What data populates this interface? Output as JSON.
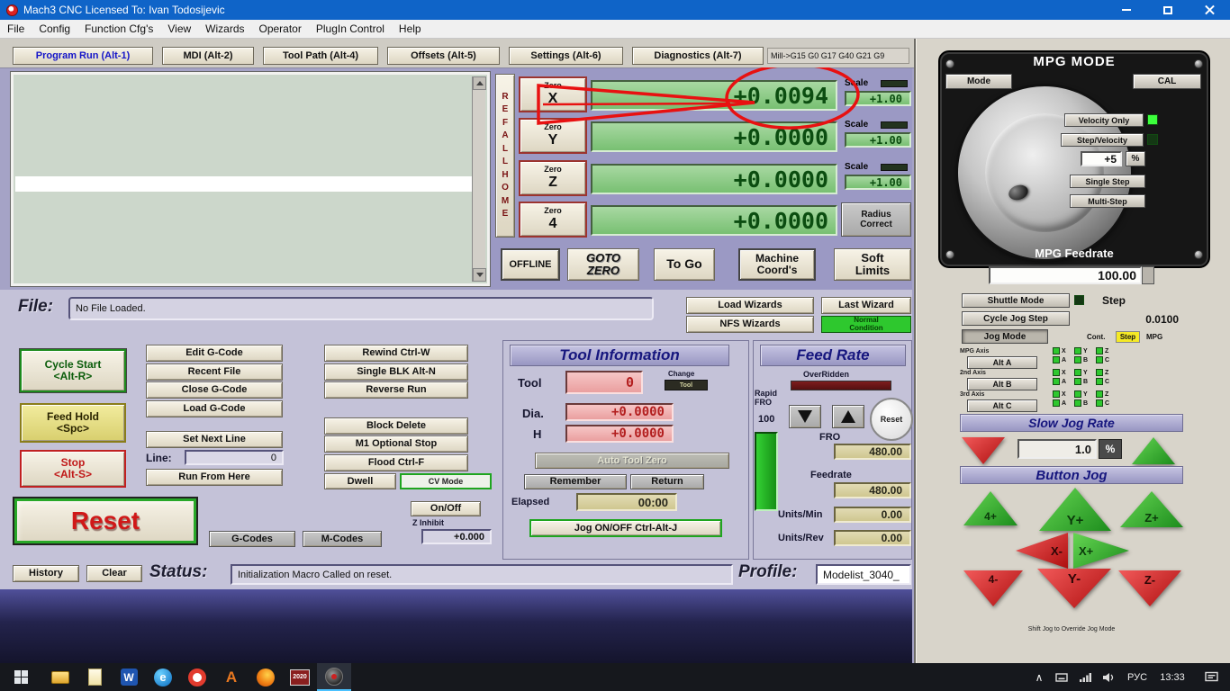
{
  "colors": {
    "titlebar_blue": "#0f64c8",
    "dro_green": "#8cc986",
    "dro_text_green": "#0b4d10",
    "annotation_red": "#e81111",
    "screen_lavender": "#a5a3c6",
    "status_green": "#2ec82e",
    "mpg_panel_black": "#161616"
  },
  "titlebar": {
    "title": "Mach3 CNC  Licensed To: Ivan Todosijevic"
  },
  "menubar": {
    "items": [
      "File",
      "Config",
      "Function Cfg's",
      "View",
      "Wizards",
      "Operator",
      "PlugIn Control",
      "Help"
    ]
  },
  "tabs": {
    "items": [
      "Program Run (Alt-1)",
      "MDI (Alt-2)",
      "Tool Path (Alt-4)",
      "Offsets (Alt-5)",
      "Settings (Alt-6)",
      "Diagnostics (Alt-7)"
    ],
    "gcode_modes": "Mill->G15  G0 G17 G40 G21 G9"
  },
  "dro": {
    "ref_all_home": "R\nE\nF\nA\nL\nL\nH\nO\nM\nE",
    "zero_word": "Zero",
    "axes": [
      {
        "letter": "X",
        "value": "+0.0094",
        "scale": "+1.00"
      },
      {
        "letter": "Y",
        "value": "+0.0000",
        "scale": "+1.00"
      },
      {
        "letter": "Z",
        "value": "+0.0000",
        "scale": "+1.00"
      },
      {
        "letter": "4",
        "value": "+0.0000"
      }
    ],
    "scale_label": "Scale",
    "radius_correct": "Radius\nCorrect",
    "offline": "OFFLINE",
    "goto_zero": "GOTO\nZERO",
    "to_go": "To Go",
    "machine_coords": "Machine\nCoord's",
    "soft_limits": "Soft\nLimits"
  },
  "file_row": {
    "label": "File:",
    "value": "No File Loaded.",
    "load_wizards": "Load Wizards",
    "last_wizard": "Last Wizard",
    "nfs_wizards": "NFS Wizards",
    "condition": "Normal\nCondition"
  },
  "run_controls": {
    "cycle_start": "Cycle Start\n<Alt-R>",
    "feed_hold": "Feed Hold\n<Spc>",
    "stop": "Stop\n<Alt-S>",
    "edit_gcode": "Edit G-Code",
    "recent_file": "Recent File",
    "close_gcode": "Close G-Code",
    "load_gcode": "Load G-Code",
    "set_next_line": "Set Next Line",
    "line_label": "Line:",
    "line_value": "0",
    "run_from_here": "Run From Here",
    "rewind": "Rewind Ctrl-W",
    "single_blk": "Single BLK Alt-N",
    "reverse_run": "Reverse Run",
    "block_delete": "Block Delete",
    "m1_optional_stop": "M1 Optional Stop",
    "flood": "Flood Ctrl-F",
    "dwell": "Dwell",
    "cv_mode": "CV Mode",
    "reset": "Reset",
    "gcodes": "G-Codes",
    "mcodes": "M-Codes",
    "on_off": "On/Off",
    "z_inhibit_label": "Z Inhibit",
    "z_inhibit_value": "+0.000"
  },
  "tool_info": {
    "title": "Tool Information",
    "tool_label": "Tool",
    "tool_value": "0",
    "change_label": "Change",
    "change_slot": "Tool",
    "dia_label": "Dia.",
    "dia_value": "+0.0000",
    "h_label": "H",
    "h_value": "+0.0000",
    "auto_tool_zero": "Auto Tool Zero",
    "remember": "Remember",
    "return": "Return",
    "elapsed_label": "Elapsed",
    "elapsed_value": "00:00",
    "jog_onoff": "Jog ON/OFF Ctrl-Alt-J"
  },
  "feed_rate": {
    "title": "Feed Rate",
    "overridden": "OverRidden",
    "rapid_label": "Rapid\nFRO",
    "rapid_value": "100",
    "reset_button": "Reset",
    "fro_label": "FRO",
    "fro_value": "480.00",
    "feedrate_label": "Feedrate",
    "feedrate_value": "480.00",
    "units_min_label": "Units/Min",
    "units_min_value": "0.00",
    "units_rev_label": "Units/Rev",
    "units_rev_value": "0.00"
  },
  "status_bar": {
    "history": "History",
    "clear": "Clear",
    "status_label": "Status:",
    "status_value": "Initialization Macro Called on reset.",
    "profile_label": "Profile:",
    "profile_value": "Modelist_3040_"
  },
  "mpg": {
    "title": "MPG MODE",
    "mode": "Mode",
    "cal": "CAL",
    "velocity_only": "Velocity Only",
    "step_velocity": "Step/Velocity",
    "step_size": "+5",
    "percent": "%",
    "single_step": "Single Step",
    "multi_step": "Multi-Step",
    "feedrate_label": "MPG Feedrate",
    "feedrate_value": "100.00",
    "shuttle_mode": "Shuttle Mode",
    "step_label": "Step",
    "cycle_jog_step": "Cycle Jog Step",
    "cycle_jog_value": "0.0100",
    "jog_mode": "Jog Mode",
    "col_cont": "Cont.",
    "col_step": "Step",
    "col_mpg": "MPG",
    "axis_rows": [
      {
        "label": "MPG Axis",
        "button": "Alt A"
      },
      {
        "label": "2nd Axis",
        "button": "Alt B"
      },
      {
        "label": "3rd Axis",
        "button": "Alt C"
      }
    ],
    "axis_letters": [
      "X",
      "Y",
      "Z",
      "A",
      "B",
      "C"
    ],
    "slow_jog_rate": "Slow Jog Rate",
    "slow_jog_value": "1.0",
    "slow_jog_percent": "%",
    "button_jog": "Button Jog",
    "jog_labels": [
      "4+",
      "Y+",
      "Z+",
      "X-",
      "X+",
      "4-",
      "Y-",
      "Z-"
    ],
    "caption": "Shift Jog to Override Jog Mode"
  },
  "taskbar": {
    "tray_expand_glyph": "∧",
    "language": "РУС",
    "time": "13:33",
    "icon_letters": {
      "word": "W",
      "edge": "e",
      "autocad": "A",
      "y2020": "2020"
    }
  }
}
